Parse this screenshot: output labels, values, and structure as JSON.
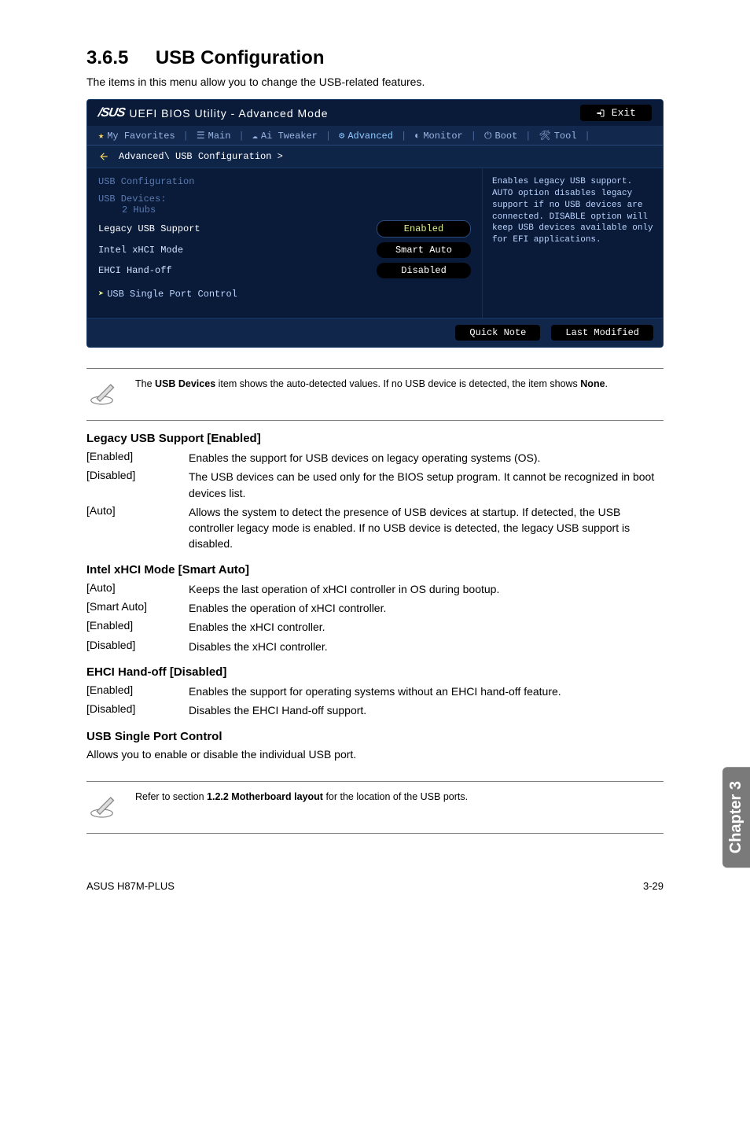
{
  "section": {
    "num": "3.6.5",
    "title": "USB Configuration"
  },
  "intro": "The items in this menu allow you to change the USB-related features.",
  "bios": {
    "logo": "/SUS",
    "window_title": "UEFI BIOS Utility - Advanced Mode",
    "exit": "Exit",
    "tabs": {
      "fav": "My Favorites",
      "main": "Main",
      "tweaker": "Ai Tweaker",
      "advanced": "Advanced",
      "monitor": "Monitor",
      "boot": "Boot",
      "tool": "Tool"
    },
    "breadcrumb": "Advanced\\ USB Configuration >",
    "left": {
      "header": "USB Configuration",
      "devices_label": "USB Devices:",
      "devices_value": "2 Hubs",
      "row1_label": "Legacy USB Support",
      "row1_value": "Enabled",
      "row2_label": "Intel xHCI Mode",
      "row2_value": "Smart Auto",
      "row3_label": "EHCI Hand-off",
      "row3_value": "Disabled",
      "sub1": "USB Single Port Control"
    },
    "help": "Enables Legacy USB support. AUTO option disables legacy support if no USB devices are connected. DISABLE option will keep USB devices available only for EFI applications.",
    "footer": {
      "quick": "Quick Note",
      "last": "Last Modified"
    }
  },
  "note1": {
    "pre": "The ",
    "bold": "USB Devices",
    "mid": " item shows the auto-detected values. If no USB device is detected, the item shows ",
    "bold2": "None",
    "post": "."
  },
  "legacy": {
    "heading": "Legacy USB Support [Enabled]",
    "enabled": "Enables the support for USB devices on legacy operating systems (OS).",
    "disabled": "The USB devices can be used only for the BIOS setup program. It cannot be recognized in boot devices list.",
    "auto": "Allows the system to detect the presence of USB devices at startup. If detected, the USB controller legacy mode is enabled. If no USB device is detected, the legacy USB support is disabled."
  },
  "xhci": {
    "heading": "Intel xHCI Mode [Smart Auto]",
    "auto": "Keeps the last operation of xHCI controller in OS during bootup.",
    "smart": "Enables the operation of xHCI controller.",
    "enabled": "Enables the xHCI controller.",
    "disabled": "Disables the xHCI controller."
  },
  "ehci": {
    "heading": "EHCI Hand-off [Disabled]",
    "enabled": "Enables the support for operating systems without an EHCI hand-off feature.",
    "disabled": "Disables the EHCI Hand-off support."
  },
  "single": {
    "heading": "USB Single Port Control",
    "text": "Allows you to enable or disable the individual USB port."
  },
  "note2": {
    "pre": "Refer to section ",
    "bold": "1.2.2 Motherboard layout",
    "post": " for the location of the USB ports."
  },
  "labels": {
    "enabled": "[Enabled]",
    "disabled": "[Disabled]",
    "auto": "[Auto]",
    "smartauto": "[Smart Auto]"
  },
  "side_tab": "Chapter 3",
  "footer": {
    "left": "ASUS H87M-PLUS",
    "right": "3-29"
  }
}
